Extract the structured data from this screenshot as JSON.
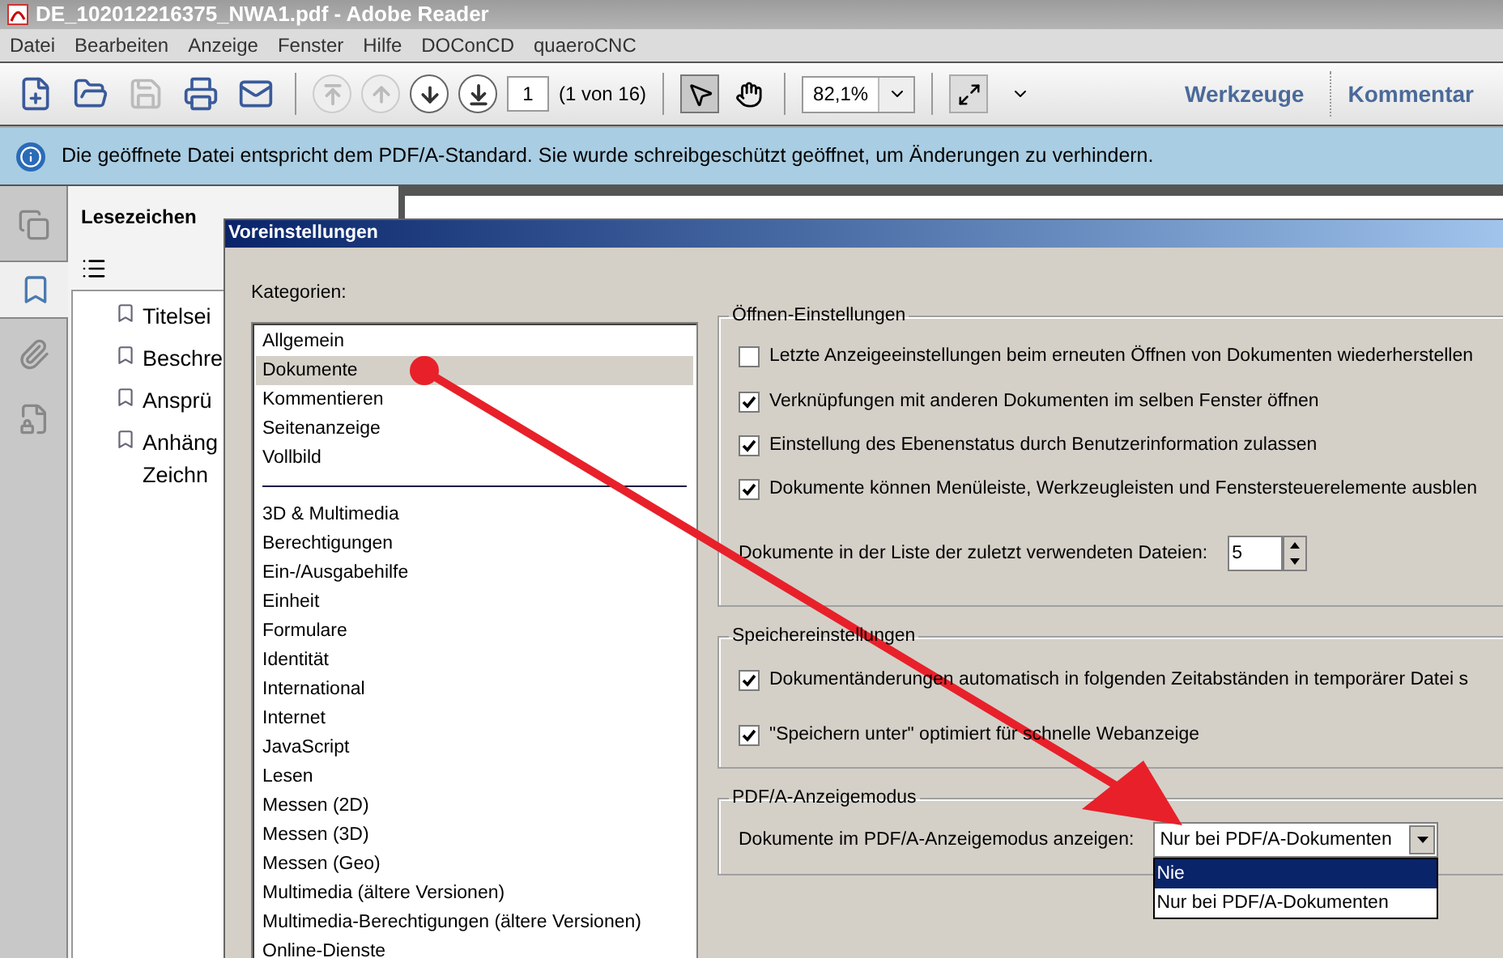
{
  "window": {
    "title": "DE_102012216375_NWA1.pdf - Adobe Reader"
  },
  "menu": [
    "Datei",
    "Bearbeiten",
    "Anzeige",
    "Fenster",
    "Hilfe",
    "DOConCD",
    "quaeroCNC"
  ],
  "toolbar": {
    "file_buttons": [
      {
        "disabled": false
      },
      {
        "disabled": false
      },
      {
        "disabled": true
      },
      {
        "disabled": false
      },
      {
        "disabled": false
      }
    ],
    "nav_buttons": [
      {
        "disabled": true
      },
      {
        "disabled": true
      },
      {
        "disabled": false
      },
      {
        "disabled": false
      }
    ],
    "page": "1",
    "page_count": "(1 von 16)",
    "tools": [
      {
        "selected": true
      },
      {
        "selected": false
      }
    ],
    "zoom": "82,1%",
    "panes": [
      "Werkzeuge",
      "Kommentar"
    ]
  },
  "info_bar": {
    "message": "Die geöffnete Datei entspricht dem PDF/A-Standard. Sie wurde schreibgeschützt geöffnet, um Änderungen zu verhindern."
  },
  "nav_tabs": [
    {
      "selected": false
    },
    {
      "selected": true
    },
    {
      "selected": false
    },
    {
      "selected": false
    }
  ],
  "bookmarks": {
    "title": "Lesezeichen",
    "items": [
      "Titelsei",
      "Beschre",
      "Ansprü",
      "Anhäng\nZeichn"
    ]
  },
  "dialog": {
    "title": "Voreinstellungen",
    "categories_label": "Kategorien:",
    "categories": [
      {
        "label": "Allgemein",
        "selected": false
      },
      {
        "label": "Dokumente",
        "selected": true
      },
      {
        "label": "Kommentieren",
        "selected": false
      },
      {
        "label": "Seitenanzeige",
        "selected": false
      },
      {
        "label": "Vollbild",
        "selected": false
      }
    ],
    "more_categories": [
      {
        "label": "3D & Multimedia",
        "selected": false
      },
      {
        "label": "Berechtigungen",
        "selected": false
      },
      {
        "label": "Ein-/Ausgabehilfe",
        "selected": false
      },
      {
        "label": "Einheit",
        "selected": false
      },
      {
        "label": "Formulare",
        "selected": false
      },
      {
        "label": "Identität",
        "selected": false
      },
      {
        "label": "International",
        "selected": false
      },
      {
        "label": "Internet",
        "selected": false
      },
      {
        "label": "JavaScript",
        "selected": false
      },
      {
        "label": "Lesen",
        "selected": false
      },
      {
        "label": "Messen (2D)",
        "selected": false
      },
      {
        "label": "Messen (3D)",
        "selected": false
      },
      {
        "label": "Messen (Geo)",
        "selected": false
      },
      {
        "label": "Multimedia (ältere Versionen)",
        "selected": false
      },
      {
        "label": "Multimedia-Berechtigungen (ältere Versionen)",
        "selected": false
      },
      {
        "label": "Online-Dienste",
        "selected": false
      }
    ],
    "open_settings": {
      "title": "Öffnen-Einstellungen",
      "options": [
        {
          "label": "Letzte Anzeigeeinstellungen beim erneuten Öffnen von Dokumenten wiederherstellen",
          "checked": false
        },
        {
          "label": "Verknüpfungen mit anderen Dokumenten im selben Fenster öffnen",
          "checked": true
        },
        {
          "label": "Einstellung des Ebenenstatus durch Benutzerinformation zulassen",
          "checked": true
        },
        {
          "label": "Dokumente können Menüleiste, Werkzeugleisten und Fenstersteuerelemente ausblen",
          "checked": true
        }
      ],
      "recent_label": "Dokumente in der Liste der zuletzt verwendeten Dateien:",
      "recent_value": "5"
    },
    "save_settings": {
      "title": "Speichereinstellungen",
      "options": [
        {
          "label": "Dokumentänderungen automatisch in folgenden Zeitabständen in temporärer Datei s",
          "checked": true
        },
        {
          "label": "\"Speichern unter\" optimiert für schnelle Webanzeige",
          "checked": true
        }
      ]
    },
    "pdfa": {
      "title": "PDF/A-Anzeigemodus",
      "label": "Dokumente im PDF/A-Anzeigemodus anzeigen:",
      "value": "Nur bei PDF/A-Dokumenten",
      "options": [
        {
          "label": "Nie",
          "highlighted": true
        },
        {
          "label": "Nur bei PDF/A-Dokumenten",
          "highlighted": false
        }
      ]
    }
  }
}
